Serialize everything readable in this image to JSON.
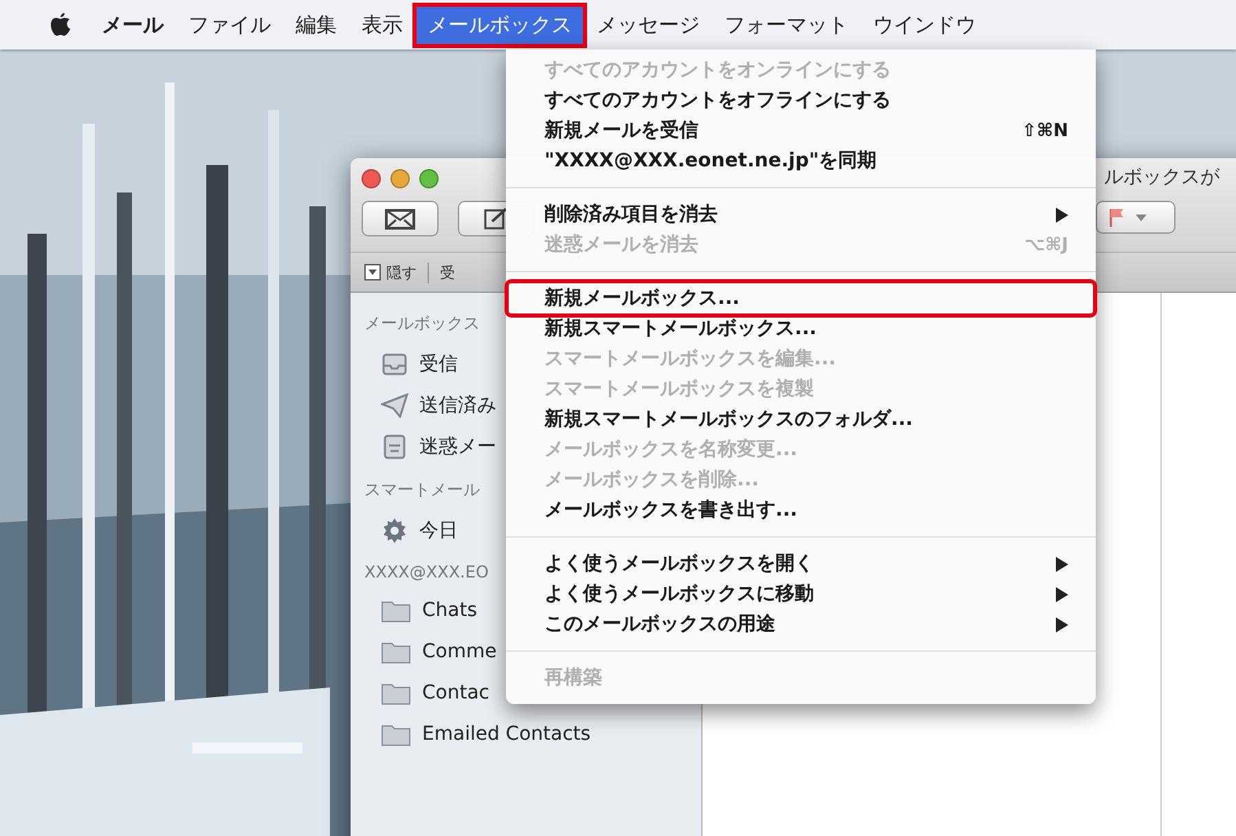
{
  "menu_bar": {
    "items": [
      {
        "label": "メール",
        "kind": "app",
        "selected": false,
        "annotated": false
      },
      {
        "label": "ファイル",
        "kind": "menu",
        "selected": false,
        "annotated": false
      },
      {
        "label": "編集",
        "kind": "menu",
        "selected": false,
        "annotated": false
      },
      {
        "label": "表示",
        "kind": "menu",
        "selected": false,
        "annotated": false
      },
      {
        "label": "メールボックス",
        "kind": "menu",
        "selected": true,
        "annotated": true
      },
      {
        "label": "メッセージ",
        "kind": "menu",
        "selected": false,
        "annotated": false
      },
      {
        "label": "フォーマット",
        "kind": "menu",
        "selected": false,
        "annotated": false
      },
      {
        "label": "ウインドウ",
        "kind": "menu",
        "selected": false,
        "annotated": false
      }
    ]
  },
  "mail_window": {
    "title": "ルボックスが",
    "favorites_bar": {
      "hide_label": "隠す",
      "next_label": "受"
    },
    "sidebar": {
      "sections": [
        {
          "heading": "メールボックス",
          "items": [
            {
              "label": "受信"
            },
            {
              "label": "送信済み"
            },
            {
              "label": "迷惑メー"
            }
          ]
        },
        {
          "heading": "スマートメール",
          "items": [
            {
              "label": "今日"
            }
          ]
        },
        {
          "heading": "XXXX@XXX.EO",
          "items": [
            {
              "label": "Chats"
            },
            {
              "label": "Comme"
            },
            {
              "label": "Contac"
            },
            {
              "label": "Emailed Contacts"
            }
          ]
        }
      ]
    }
  },
  "dropdown_menu": {
    "items": [
      {
        "kind": "item",
        "label": "すべてのアカウントをオンラインにする",
        "disabled": true,
        "annotated": false
      },
      {
        "kind": "item",
        "label": "すべてのアカウントをオフラインにする",
        "disabled": false,
        "annotated": false
      },
      {
        "kind": "item",
        "label": "新規メールを受信",
        "shortcut": "⇧⌘N",
        "disabled": false,
        "annotated": false
      },
      {
        "kind": "item",
        "label": "\"XXXX@XXX.eonet.ne.jp\"を同期",
        "disabled": false,
        "annotated": false
      },
      {
        "kind": "separator"
      },
      {
        "kind": "item",
        "label": "削除済み項目を消去",
        "submenu": true,
        "disabled": false,
        "annotated": false
      },
      {
        "kind": "item",
        "label": "迷惑メールを消去",
        "shortcut": "⌥⌘J",
        "disabled": true,
        "annotated": false
      },
      {
        "kind": "separator"
      },
      {
        "kind": "item",
        "label": "新規メールボックス...",
        "disabled": false,
        "annotated": true
      },
      {
        "kind": "item",
        "label": "新規スマートメールボックス...",
        "disabled": false,
        "annotated": false
      },
      {
        "kind": "item",
        "label": "スマートメールボックスを編集...",
        "disabled": true,
        "annotated": false
      },
      {
        "kind": "item",
        "label": "スマートメールボックスを複製",
        "disabled": true,
        "annotated": false
      },
      {
        "kind": "item",
        "label": "新規スマートメールボックスのフォルダ...",
        "disabled": false,
        "annotated": false
      },
      {
        "kind": "item",
        "label": "メールボックスを名称変更...",
        "disabled": true,
        "annotated": false
      },
      {
        "kind": "item",
        "label": "メールボックスを削除...",
        "disabled": true,
        "annotated": false
      },
      {
        "kind": "item",
        "label": "メールボックスを書き出す...",
        "disabled": false,
        "annotated": false
      },
      {
        "kind": "separator"
      },
      {
        "kind": "item",
        "label": "よく使うメールボックスを開く",
        "submenu": true,
        "disabled": false,
        "annotated": false
      },
      {
        "kind": "item",
        "label": "よく使うメールボックスに移動",
        "submenu": true,
        "disabled": false,
        "annotated": false
      },
      {
        "kind": "item",
        "label": "このメールボックスの用途",
        "submenu": true,
        "disabled": false,
        "annotated": false
      },
      {
        "kind": "separator"
      },
      {
        "kind": "item",
        "label": "再構築",
        "disabled": true,
        "annotated": false
      }
    ]
  }
}
